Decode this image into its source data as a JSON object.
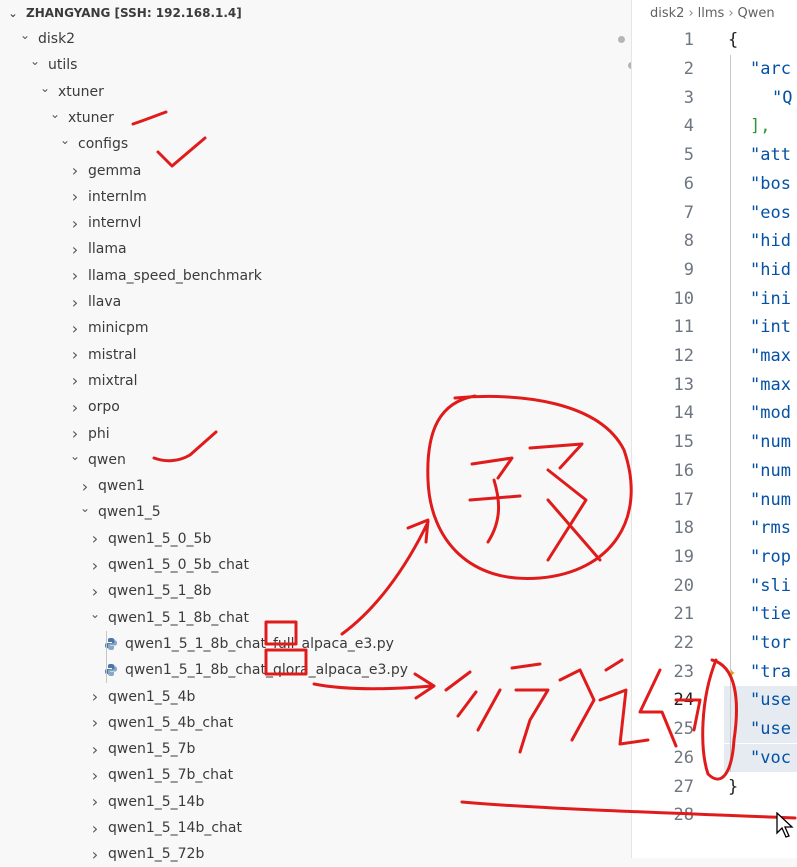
{
  "explorer": {
    "root_title": "ZHANGYANG [SSH: 192.168.1.4]",
    "tree": [
      {
        "label": "disk2",
        "depth": 0,
        "chev": "v",
        "modified": true
      },
      {
        "label": "utils",
        "depth": 1,
        "chev": "v",
        "modified": true
      },
      {
        "label": "xtuner",
        "depth": 2,
        "chev": "v"
      },
      {
        "label": "xtuner",
        "depth": 3,
        "chev": "v"
      },
      {
        "label": "configs",
        "depth": 4,
        "chev": "v"
      },
      {
        "label": "gemma",
        "depth": 5,
        "chev": ">"
      },
      {
        "label": "internlm",
        "depth": 5,
        "chev": ">"
      },
      {
        "label": "internvl",
        "depth": 5,
        "chev": ">"
      },
      {
        "label": "llama",
        "depth": 5,
        "chev": ">"
      },
      {
        "label": "llama_speed_benchmark",
        "depth": 5,
        "chev": ">"
      },
      {
        "label": "llava",
        "depth": 5,
        "chev": ">"
      },
      {
        "label": "minicpm",
        "depth": 5,
        "chev": ">"
      },
      {
        "label": "mistral",
        "depth": 5,
        "chev": ">"
      },
      {
        "label": "mixtral",
        "depth": 5,
        "chev": ">"
      },
      {
        "label": "orpo",
        "depth": 5,
        "chev": ">"
      },
      {
        "label": "phi",
        "depth": 5,
        "chev": ">"
      },
      {
        "label": "qwen",
        "depth": 5,
        "chev": "v"
      },
      {
        "label": "qwen1",
        "depth": 6,
        "chev": ">"
      },
      {
        "label": "qwen1_5",
        "depth": 6,
        "chev": "v"
      },
      {
        "label": "qwen1_5_0_5b",
        "depth": 7,
        "chev": ">"
      },
      {
        "label": "qwen1_5_0_5b_chat",
        "depth": 7,
        "chev": ">"
      },
      {
        "label": "qwen1_5_1_8b",
        "depth": 7,
        "chev": ">"
      },
      {
        "label": "qwen1_5_1_8b_chat",
        "depth": 7,
        "chev": "v"
      },
      {
        "label": "qwen1_5_1_8b_chat_full_alpaca_e3.py",
        "depth": 8,
        "file": true
      },
      {
        "label": "qwen1_5_1_8b_chat_qlora_alpaca_e3.py",
        "depth": 8,
        "file": true
      },
      {
        "label": "qwen1_5_4b",
        "depth": 7,
        "chev": ">"
      },
      {
        "label": "qwen1_5_4b_chat",
        "depth": 7,
        "chev": ">"
      },
      {
        "label": "qwen1_5_7b",
        "depth": 7,
        "chev": ">"
      },
      {
        "label": "qwen1_5_7b_chat",
        "depth": 7,
        "chev": ">"
      },
      {
        "label": "qwen1_5_14b",
        "depth": 7,
        "chev": ">"
      },
      {
        "label": "qwen1_5_14b_chat",
        "depth": 7,
        "chev": ">"
      },
      {
        "label": "qwen1_5_72b",
        "depth": 7,
        "chev": ">"
      }
    ]
  },
  "editor": {
    "breadcrumbs": [
      "disk2",
      "llms",
      "Qwen"
    ],
    "lines": [
      {
        "n": "1",
        "text": "{",
        "kind": "brace"
      },
      {
        "n": "2",
        "text": "\"arc",
        "indent": 1
      },
      {
        "n": "3",
        "text": "\"Q",
        "indent": 2
      },
      {
        "n": "4",
        "text": "],",
        "indent": 1,
        "kind": "bracket"
      },
      {
        "n": "5",
        "text": "\"att",
        "indent": 1
      },
      {
        "n": "6",
        "text": "\"bos",
        "indent": 1
      },
      {
        "n": "7",
        "text": "\"eos",
        "indent": 1
      },
      {
        "n": "8",
        "text": "\"hid",
        "indent": 1
      },
      {
        "n": "9",
        "text": "\"hid",
        "indent": 1
      },
      {
        "n": "10",
        "text": "\"ini",
        "indent": 1
      },
      {
        "n": "11",
        "text": "\"int",
        "indent": 1
      },
      {
        "n": "12",
        "text": "\"max",
        "indent": 1
      },
      {
        "n": "13",
        "text": "\"max",
        "indent": 1
      },
      {
        "n": "14",
        "text": "\"mod",
        "indent": 1
      },
      {
        "n": "15",
        "text": "\"num",
        "indent": 1
      },
      {
        "n": "16",
        "text": "\"num",
        "indent": 1
      },
      {
        "n": "17",
        "text": "\"num",
        "indent": 1
      },
      {
        "n": "18",
        "text": "\"rms",
        "indent": 1
      },
      {
        "n": "19",
        "text": "\"rop",
        "indent": 1
      },
      {
        "n": "20",
        "text": "\"sli",
        "indent": 1
      },
      {
        "n": "21",
        "text": "\"tie",
        "indent": 1
      },
      {
        "n": "22",
        "text": "\"tor",
        "indent": 1
      },
      {
        "n": "23",
        "text": "\"tra",
        "indent": 1,
        "spark": true
      },
      {
        "n": "24",
        "text": "\"use",
        "indent": 1,
        "current": true,
        "selected": true
      },
      {
        "n": "25",
        "text": "\"use",
        "indent": 1,
        "selected": true
      },
      {
        "n": "26",
        "text": "\"voc",
        "indent": 1,
        "selected": true
      },
      {
        "n": "27",
        "text": "}",
        "kind": "brace"
      },
      {
        "n": "28",
        "text": ""
      }
    ]
  },
  "annotations": {
    "circle_text": "预",
    "arrow_text": "微调",
    "boxed_words": [
      "full",
      "qlora"
    ],
    "ink_color": "#e01b1b"
  }
}
